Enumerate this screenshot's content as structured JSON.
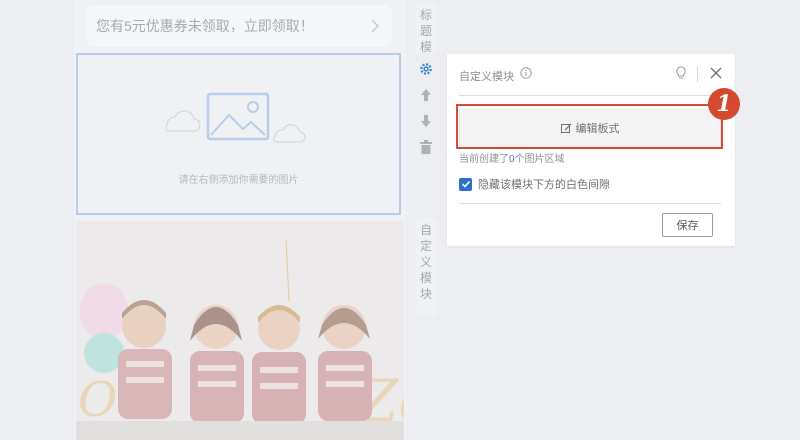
{
  "coupon": {
    "text": "您有5元优惠券未领取，立即领取！"
  },
  "image_module": {
    "hint": "请在右侧添加你需要的图片"
  },
  "tabs": {
    "title_tab": "标题模",
    "custom_tab": "自定义模块"
  },
  "panel": {
    "title": "自定义模块",
    "edit_label": "编辑板式",
    "count_prefix": "当前创建了",
    "count_value": "0",
    "count_suffix": "个图片区域",
    "checkbox_label": "隐藏该模块下方的白色间隙",
    "checkbox_checked": true,
    "save_label": "保存"
  },
  "annotation": {
    "badge": "1"
  },
  "colors": {
    "accent": "#2f6fc9",
    "highlight": "#d94a32"
  },
  "icons": [
    "chevron-right-icon",
    "image-placeholder-icon",
    "gear-icon",
    "arrow-up-icon",
    "arrow-down-icon",
    "trash-icon",
    "info-icon",
    "lightbulb-icon",
    "close-icon",
    "edit-icon",
    "check-icon"
  ]
}
